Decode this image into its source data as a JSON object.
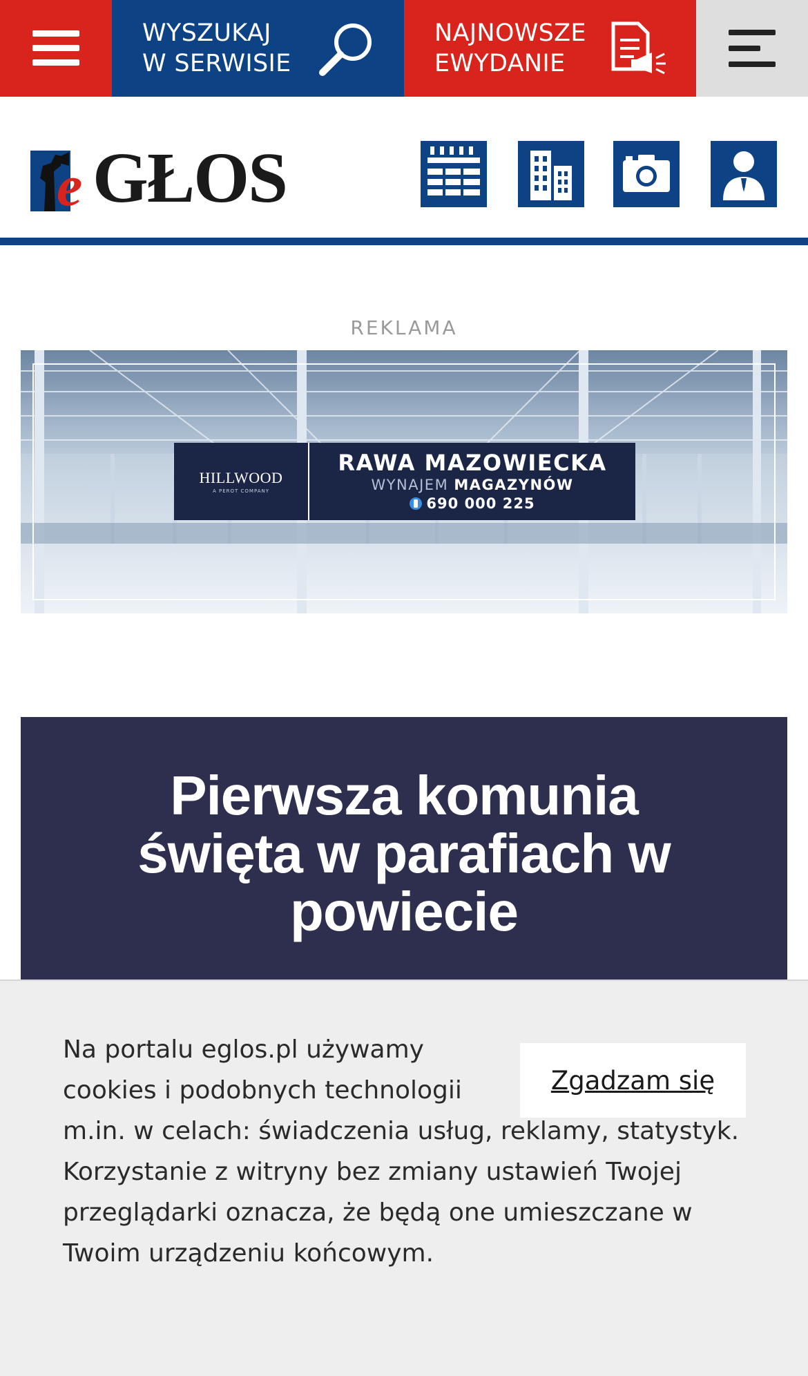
{
  "topbar": {
    "menu_icon": "hamburger-icon",
    "search_label": "WYSZUKAJ\nW SERWISIE",
    "search_icon": "magnifier-icon",
    "edition_label": "NAJNOWSZE\nEWYDANIE",
    "edition_icon": "document-megaphone-icon",
    "right_icon": "align-left-menu-icon",
    "colors": {
      "red": "#d8241c",
      "blue": "#0d4384",
      "gray": "#dedede"
    }
  },
  "header": {
    "logo_prefix": "e",
    "logo_text": "GŁOS",
    "icons": [
      "calendar-icon",
      "buildings-icon",
      "camera-icon",
      "person-icon"
    ]
  },
  "ad": {
    "label": "REKLAMA",
    "brand": "HILLWOOD",
    "brand_sub": "A PEROT COMPANY",
    "city": "RAWA MAZOWIECKA",
    "sub_prefix": "WYNAJEM",
    "sub_bold": "MAGAZYNÓW",
    "phone": "690 000 225"
  },
  "article": {
    "title": "Pierwsza komunia święta w parafiach w powiecie"
  },
  "cookie": {
    "text": "Na portalu eglos.pl używamy cookies i podobnych technologii m.in. w celach: świadczenia usług, reklamy, statystyk. Korzystanie z witryny bez zmiany ustawień Twojej przeglądarki oznacza, że będą one umieszczane w Twoim urządzeniu końcowym.",
    "accept_label": "Zgadzam się"
  }
}
